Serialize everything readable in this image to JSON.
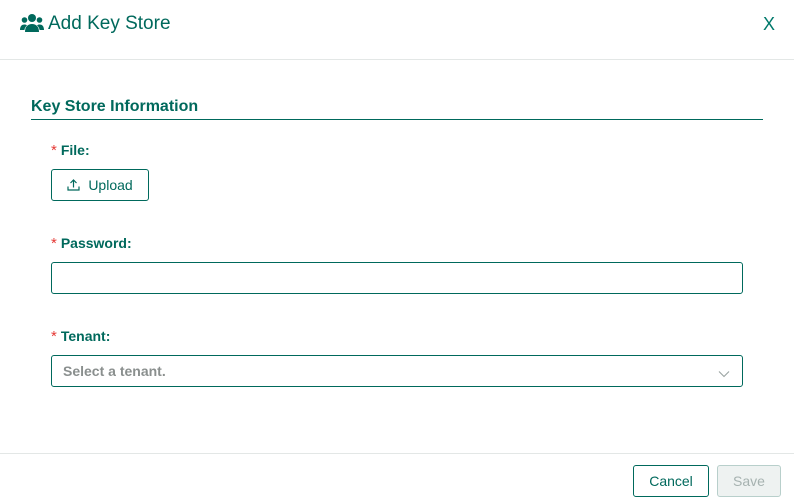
{
  "dialog": {
    "title": "Add Key Store",
    "title_icon": "users-icon",
    "close_label": "X"
  },
  "section": {
    "title": "Key Store Information"
  },
  "fields": {
    "required_mark": "*",
    "file": {
      "label": "File:",
      "upload_label": "Upload",
      "upload_icon": "upload-icon"
    },
    "password": {
      "label": "Password:",
      "value": "",
      "placeholder": ""
    },
    "tenant": {
      "label": "Tenant:",
      "placeholder": "Select a tenant.",
      "chevron_icon": "chevron-down-icon"
    }
  },
  "footer": {
    "cancel_label": "Cancel",
    "save_label": "Save"
  },
  "colors": {
    "accent": "#00695c",
    "required": "#e53935",
    "disabled_text": "#a6b2b0",
    "disabled_bg": "#eef2f1",
    "placeholder": "#8a8f8e"
  }
}
